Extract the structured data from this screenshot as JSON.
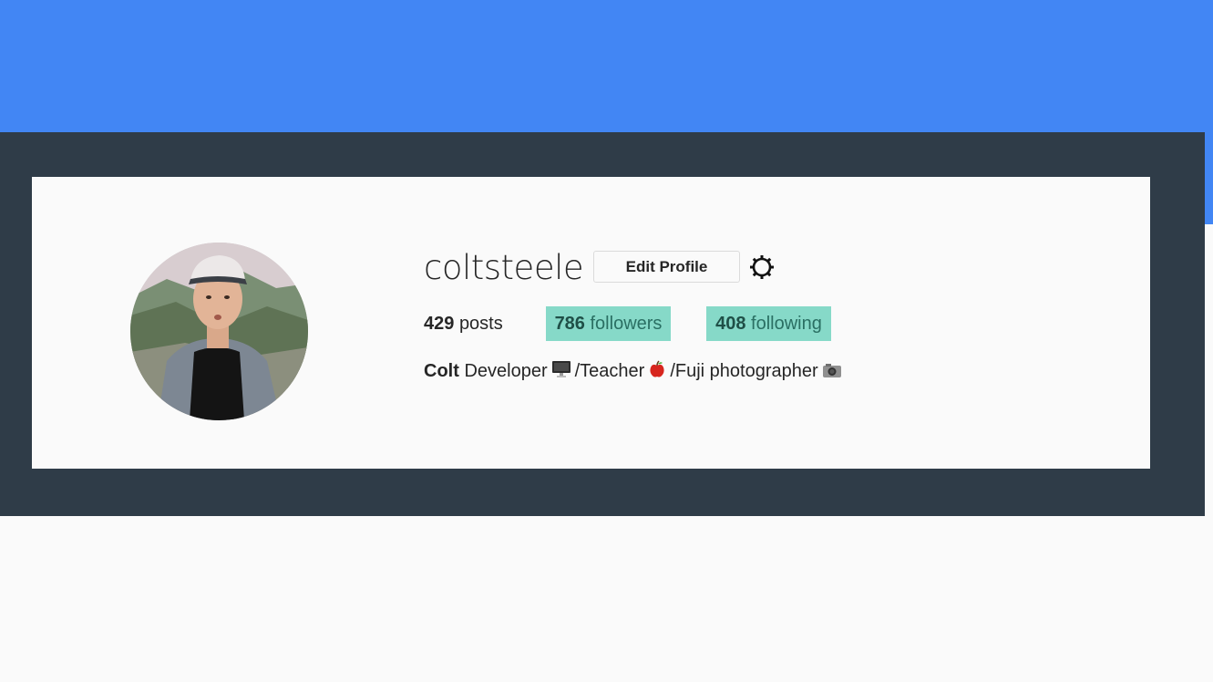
{
  "profile": {
    "username": "coltsteele",
    "edit_button_label": "Edit Profile",
    "settings_icon": "gear-icon",
    "avatar_icon": "profile-photo",
    "stats": {
      "posts_count": "429",
      "posts_label": "posts",
      "followers_count": "786",
      "followers_label": "followers",
      "following_count": "408",
      "following_label": "following"
    },
    "bio": {
      "name": "Colt",
      "text_1": "Developer",
      "icon_1": "desktop-computer-emoji",
      "text_2": "/Teacher",
      "icon_2": "apple-emoji",
      "text_3": "/Fuji photographer",
      "icon_3": "camera-emoji"
    }
  },
  "colors": {
    "top_band": "#4286f4",
    "dark_frame": "#2f3c48",
    "card_bg": "#fafafa",
    "highlight": "#86d9c8"
  }
}
